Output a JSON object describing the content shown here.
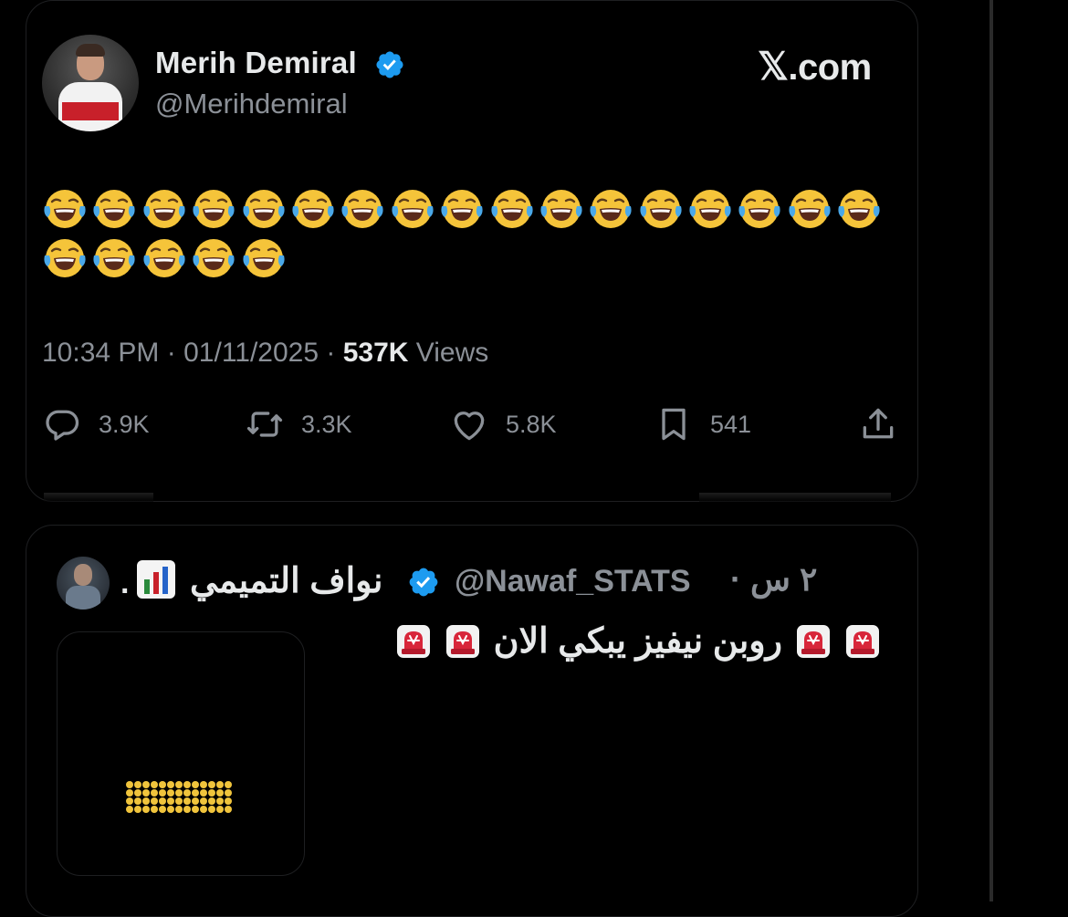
{
  "main_post": {
    "author_name": "Merih Demiral",
    "handle": "@Merihdemiral",
    "source_label": ".com",
    "source_mark": "𝕏",
    "emoji_name": "face-with-tears-of-joy",
    "emoji_count_row1": 17,
    "emoji_count_row2": 5,
    "time": "10:34 PM",
    "date": "01/11/2025",
    "separator": "·",
    "views_count": "537K",
    "views_label": "Views",
    "replies": "3.9K",
    "reposts": "3.3K",
    "likes": "5.8K",
    "bookmarks": "541"
  },
  "reply_post": {
    "author_name": "نواف التميمي",
    "handle": "@Nawaf_STATS",
    "time": "٢ س ·",
    "dot": ".",
    "text": "روبن نيفيز يبكي الان",
    "emoji_before_name": "bar-chart",
    "siren_count_right": 2,
    "siren_count_left": 2
  },
  "colors": {
    "background": "#000000",
    "text_primary": "#e7e9ea",
    "text_secondary": "#8b9097",
    "verified_blue": "#1d9bf0",
    "card_border": "#1e1f21"
  }
}
